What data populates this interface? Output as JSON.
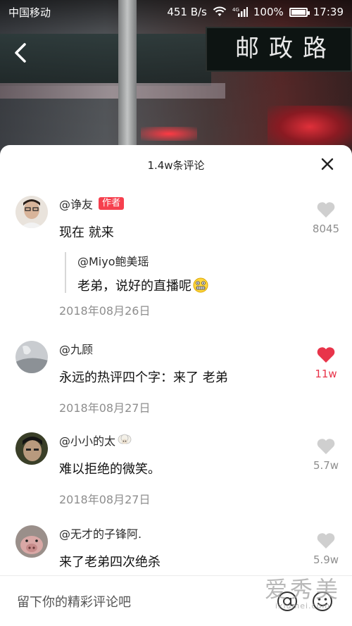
{
  "status_bar": {
    "carrier": "中国移动",
    "net_speed": "451 B/s",
    "network_badge": "4G",
    "battery": "100%",
    "time": "17:39"
  },
  "background": {
    "road_sign_text": "邮政路"
  },
  "panel": {
    "title": "1.4w条评论"
  },
  "comments": [
    {
      "username": "@诤友",
      "badge": "作者",
      "text": "现在 就来",
      "likes": "8045",
      "liked": false,
      "reply": {
        "username": "@Miyo鲍美瑶",
        "text": "老弟，说好的直播呢",
        "emoji": "grimacing-emoji"
      },
      "date": "2018年08月26日"
    },
    {
      "username": "@九顾",
      "text": "永远的热评四个字：来了 老弟",
      "likes": "11w",
      "liked": true,
      "date": "2018年08月27日"
    },
    {
      "username": "@小小的太",
      "username_icon": "sheep-emoji",
      "text": "难以拒绝的微笑。",
      "likes": "5.7w",
      "liked": false,
      "date": "2018年08月27日"
    },
    {
      "username": "@无才的子锋阿.",
      "text": "来了老弟四次绝杀",
      "likes": "5.9w",
      "liked": false
    }
  ],
  "input": {
    "placeholder": "留下你的精彩评论吧"
  },
  "watermark": {
    "main": "爱秀美",
    "sub": "ixiumei.com"
  },
  "colors": {
    "accent_red": "#f6404e",
    "like_red": "#e8344a",
    "grey_text": "#8e8e8e"
  }
}
